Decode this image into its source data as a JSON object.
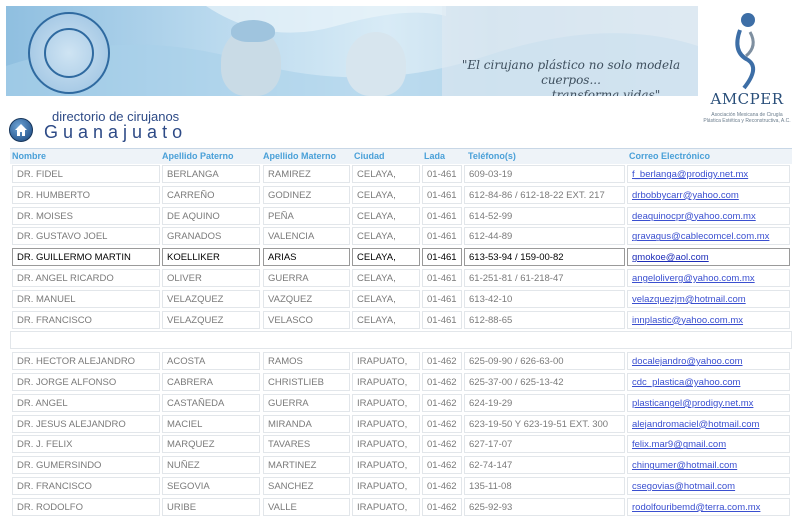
{
  "banner": {
    "quote_line1": "\"El cirujano plástico no solo modela cuerpos...",
    "quote_line2": "transforma vidas\"",
    "seal_text": "CIRUGÍA PLÁSTICA ESTÉTICA Y RECONSTRUCTIVA"
  },
  "logo": {
    "name": "AMCPER",
    "subtitle": "Asociación Mexicana de Cirugía Plástica Estética y Reconstructiva, A.C."
  },
  "page": {
    "directory_title": "directorio de cirujanos",
    "state_title": "Guanajuato"
  },
  "icons": {
    "home": "home-icon"
  },
  "colors": {
    "header_text": "#4aa0d8",
    "title": "#2d4a86",
    "link": "#3a4fd0"
  },
  "table": {
    "columns": [
      "Nombre",
      "Apellido Paterno",
      "Apellido Materno",
      "Ciudad",
      "Lada",
      "Teléfono(s)",
      "Correo Electrónico"
    ],
    "group1": [
      [
        "DR. FIDEL",
        "BERLANGA",
        "RAMIREZ",
        "CELAYA,",
        "01-461",
        "609-03-19",
        "f_berlanga@prodigy.net.mx"
      ],
      [
        "DR. HUMBERTO",
        "CARREÑO",
        "GODINEZ",
        "CELAYA,",
        "01-461",
        "612-84-86 / 612-18-22 EXT. 217",
        "drbobbycarr@yahoo.com"
      ],
      [
        "DR. MOISES",
        "DE AQUINO",
        "PEÑA",
        "CELAYA,",
        "01-461",
        "614-52-99",
        "deaquinocpr@yahoo.com.mx"
      ],
      [
        "DR. GUSTAVO JOEL",
        "GRANADOS",
        "VALENCIA",
        "CELAYA,",
        "01-461",
        "612-44-89",
        "gravagus@cablecomcel.com.mx"
      ],
      [
        "DR. GUILLERMO MARTIN",
        "KOELLIKER",
        "ARIAS",
        "CELAYA,",
        "01-461",
        "613-53-94 / 159-00-82",
        "gmokoe@aol.com"
      ],
      [
        "DR. ANGEL RICARDO",
        "OLIVER",
        "GUERRA",
        "CELAYA,",
        "01-461",
        "61-251-81 / 61-218-47",
        "angeloliverg@yahoo.com.mx"
      ],
      [
        "DR. MANUEL",
        "VELAZQUEZ",
        "VAZQUEZ",
        "CELAYA,",
        "01-461",
        "613-42-10",
        "velazquezjm@hotmail.com"
      ],
      [
        "DR. FRANCISCO",
        "VELAZQUEZ",
        "VELASCO",
        "CELAYA,",
        "01-461",
        "612-88-65",
        "innplastic@yahoo.com.mx"
      ]
    ],
    "group2": [
      [
        "DR. HECTOR ALEJANDRO",
        "ACOSTA",
        "RAMOS",
        "IRAPUATO,",
        "01-462",
        "625-09-90 / 626-63-00",
        "docalejandro@yahoo.com"
      ],
      [
        "DR. JORGE ALFONSO",
        "CABRERA",
        "CHRISTLIEB",
        "IRAPUATO,",
        "01-462",
        "625-37-00 / 625-13-42",
        "cdc_plastica@yahoo.com"
      ],
      [
        "DR. ANGEL",
        "CASTAÑEDA",
        "GUERRA",
        "IRAPUATO,",
        "01-462",
        "624-19-29",
        "plasticangel@prodigy.net.mx"
      ],
      [
        "DR. JESUS ALEJANDRO",
        "MACIEL",
        "MIRANDA",
        "IRAPUATO,",
        "01-462",
        "623-19-50 Y 623-19-51 EXT. 300",
        "alejandromaciel@hotmail.com"
      ],
      [
        "DR. J. FELIX",
        "MARQUEZ",
        "TAVARES",
        "IRAPUATO,",
        "01-462",
        "627-17-07",
        "felix.mar9@gmail.com"
      ],
      [
        "DR. GUMERSINDO",
        "NUÑEZ",
        "MARTINEZ",
        "IRAPUATO,",
        "01-462",
        "62-74-147",
        "chingumer@hotmail.com"
      ],
      [
        "DR. FRANCISCO",
        "SEGOVIA",
        "SANCHEZ",
        "IRAPUATO,",
        "01-462",
        "135-11-08",
        "csegovias@hotmail.com"
      ],
      [
        "DR. RODOLFO",
        "URIBE",
        "VALLE",
        "IRAPUATO,",
        "01-462",
        "625-92-93",
        "rodolfouribemd@terra.com.mx"
      ]
    ]
  }
}
